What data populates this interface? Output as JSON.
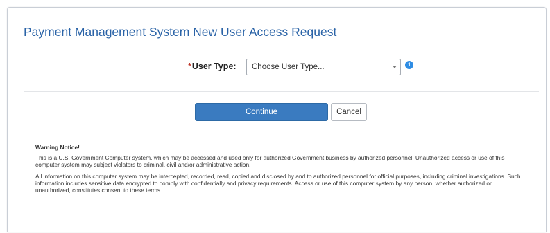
{
  "page": {
    "title": "Payment Management System New User Access Request"
  },
  "form": {
    "user_type": {
      "required_mark": "*",
      "label": "User Type:",
      "selected": "Choose User Type...",
      "info_icon": "info-icon"
    }
  },
  "actions": {
    "continue_label": "Continue",
    "cancel_label": "Cancel"
  },
  "warning": {
    "title": "Warning Notice!",
    "paragraphs": [
      "This is a U.S. Government Computer system, which may be accessed and used only for authorized Government business by authorized personnel. Unauthorized access or use of this computer system may subject violators to criminal, civil and/or administrative action.",
      "All information on this computer system may be intercepted, recorded, read, copied and disclosed by and to authorized personnel for official purposes, including criminal investigations. Such information includes sensitive data encrypted to comply with confidentially and privacy requirements. Access or use of this computer system by any person, whether authorized or unauthorized, constitutes consent to these terms."
    ]
  },
  "colors": {
    "title": "#2a63a7",
    "primary_button": "#3a7bc0",
    "info_icon": "#2f8de4",
    "required": "#c0392b"
  }
}
